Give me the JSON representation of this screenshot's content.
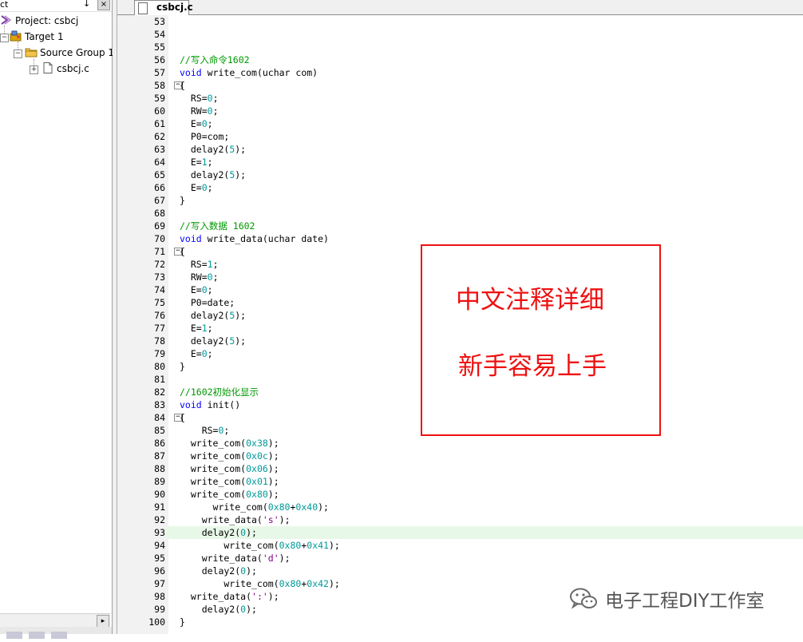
{
  "project_panel": {
    "title": "ct",
    "pin": "↓",
    "close": "×",
    "tree": [
      {
        "label": "Project: csbcj",
        "icon": "project-icon"
      },
      {
        "label": "Target 1",
        "icon": "target-icon"
      },
      {
        "label": "Source Group 1",
        "icon": "folder-icon"
      },
      {
        "label": "csbcj.c",
        "icon": "file-icon"
      }
    ],
    "scroll_right": "▸"
  },
  "editor": {
    "tab_label": "csbcj.c",
    "highlight_line": "93",
    "lines": [
      {
        "n": "53",
        "fold": "",
        "code": []
      },
      {
        "n": "54",
        "fold": "",
        "code": []
      },
      {
        "n": "55",
        "fold": "",
        "code": []
      },
      {
        "n": "56",
        "fold": "",
        "code": [
          {
            "t": "//写入命令1602",
            "c": "cm"
          }
        ]
      },
      {
        "n": "57",
        "fold": "",
        "code": [
          {
            "t": "void",
            "c": "kw"
          },
          {
            "t": " write_com(uchar com)",
            "c": ""
          }
        ]
      },
      {
        "n": "58",
        "fold": "−",
        "code": [
          {
            "t": "{",
            "c": ""
          }
        ]
      },
      {
        "n": "59",
        "fold": "",
        "code": [
          {
            "t": "  RS=",
            "c": ""
          },
          {
            "t": "0",
            "c": "nm"
          },
          {
            "t": ";",
            "c": ""
          }
        ]
      },
      {
        "n": "60",
        "fold": "",
        "code": [
          {
            "t": "  RW=",
            "c": ""
          },
          {
            "t": "0",
            "c": "nm"
          },
          {
            "t": ";",
            "c": ""
          }
        ]
      },
      {
        "n": "61",
        "fold": "",
        "code": [
          {
            "t": "  E=",
            "c": ""
          },
          {
            "t": "0",
            "c": "nm"
          },
          {
            "t": ";",
            "c": ""
          }
        ]
      },
      {
        "n": "62",
        "fold": "",
        "code": [
          {
            "t": "  P0=com;",
            "c": ""
          }
        ]
      },
      {
        "n": "63",
        "fold": "",
        "code": [
          {
            "t": "  delay2(",
            "c": ""
          },
          {
            "t": "5",
            "c": "nm"
          },
          {
            "t": ");",
            "c": ""
          }
        ]
      },
      {
        "n": "64",
        "fold": "",
        "code": [
          {
            "t": "  E=",
            "c": ""
          },
          {
            "t": "1",
            "c": "nm"
          },
          {
            "t": ";",
            "c": ""
          }
        ]
      },
      {
        "n": "65",
        "fold": "",
        "code": [
          {
            "t": "  delay2(",
            "c": ""
          },
          {
            "t": "5",
            "c": "nm"
          },
          {
            "t": ");",
            "c": ""
          }
        ]
      },
      {
        "n": "66",
        "fold": "",
        "code": [
          {
            "t": "  E=",
            "c": ""
          },
          {
            "t": "0",
            "c": "nm"
          },
          {
            "t": ";",
            "c": ""
          }
        ]
      },
      {
        "n": "67",
        "fold": "",
        "code": [
          {
            "t": "}",
            "c": ""
          }
        ]
      },
      {
        "n": "68",
        "fold": "",
        "code": []
      },
      {
        "n": "69",
        "fold": "",
        "code": [
          {
            "t": "//写入数据 1602",
            "c": "cm"
          }
        ]
      },
      {
        "n": "70",
        "fold": "",
        "code": [
          {
            "t": "void",
            "c": "kw"
          },
          {
            "t": " write_data(uchar date)",
            "c": ""
          }
        ]
      },
      {
        "n": "71",
        "fold": "−",
        "code": [
          {
            "t": "{",
            "c": ""
          }
        ]
      },
      {
        "n": "72",
        "fold": "",
        "code": [
          {
            "t": "  RS=",
            "c": ""
          },
          {
            "t": "1",
            "c": "nm"
          },
          {
            "t": ";",
            "c": ""
          }
        ]
      },
      {
        "n": "73",
        "fold": "",
        "code": [
          {
            "t": "  RW=",
            "c": ""
          },
          {
            "t": "0",
            "c": "nm"
          },
          {
            "t": ";",
            "c": ""
          }
        ]
      },
      {
        "n": "74",
        "fold": "",
        "code": [
          {
            "t": "  E=",
            "c": ""
          },
          {
            "t": "0",
            "c": "nm"
          },
          {
            "t": ";",
            "c": ""
          }
        ]
      },
      {
        "n": "75",
        "fold": "",
        "code": [
          {
            "t": "  P0=date;",
            "c": ""
          }
        ]
      },
      {
        "n": "76",
        "fold": "",
        "code": [
          {
            "t": "  delay2(",
            "c": ""
          },
          {
            "t": "5",
            "c": "nm"
          },
          {
            "t": ");",
            "c": ""
          }
        ]
      },
      {
        "n": "77",
        "fold": "",
        "code": [
          {
            "t": "  E=",
            "c": ""
          },
          {
            "t": "1",
            "c": "nm"
          },
          {
            "t": ";",
            "c": ""
          }
        ]
      },
      {
        "n": "78",
        "fold": "",
        "code": [
          {
            "t": "  delay2(",
            "c": ""
          },
          {
            "t": "5",
            "c": "nm"
          },
          {
            "t": ");",
            "c": ""
          }
        ]
      },
      {
        "n": "79",
        "fold": "",
        "code": [
          {
            "t": "  E=",
            "c": ""
          },
          {
            "t": "0",
            "c": "nm"
          },
          {
            "t": ";",
            "c": ""
          }
        ]
      },
      {
        "n": "80",
        "fold": "",
        "code": [
          {
            "t": "}",
            "c": ""
          }
        ]
      },
      {
        "n": "81",
        "fold": "",
        "code": []
      },
      {
        "n": "82",
        "fold": "",
        "code": [
          {
            "t": "//1602初始化显示",
            "c": "cm"
          }
        ]
      },
      {
        "n": "83",
        "fold": "",
        "code": [
          {
            "t": "void",
            "c": "kw"
          },
          {
            "t": " init()",
            "c": ""
          }
        ]
      },
      {
        "n": "84",
        "fold": "−",
        "code": [
          {
            "t": "{",
            "c": ""
          }
        ]
      },
      {
        "n": "85",
        "fold": "",
        "code": [
          {
            "t": "    RS=",
            "c": ""
          },
          {
            "t": "0",
            "c": "nm"
          },
          {
            "t": ";",
            "c": ""
          }
        ]
      },
      {
        "n": "86",
        "fold": "",
        "code": [
          {
            "t": "  write_com(",
            "c": ""
          },
          {
            "t": "0x38",
            "c": "nm"
          },
          {
            "t": ");",
            "c": ""
          }
        ]
      },
      {
        "n": "87",
        "fold": "",
        "code": [
          {
            "t": "  write_com(",
            "c": ""
          },
          {
            "t": "0x0c",
            "c": "nm"
          },
          {
            "t": ");",
            "c": ""
          }
        ]
      },
      {
        "n": "88",
        "fold": "",
        "code": [
          {
            "t": "  write_com(",
            "c": ""
          },
          {
            "t": "0x06",
            "c": "nm"
          },
          {
            "t": ");",
            "c": ""
          }
        ]
      },
      {
        "n": "89",
        "fold": "",
        "code": [
          {
            "t": "  write_com(",
            "c": ""
          },
          {
            "t": "0x01",
            "c": "nm"
          },
          {
            "t": ");",
            "c": ""
          }
        ]
      },
      {
        "n": "90",
        "fold": "",
        "code": [
          {
            "t": "  write_com(",
            "c": ""
          },
          {
            "t": "0x80",
            "c": "nm"
          },
          {
            "t": ");",
            "c": ""
          }
        ]
      },
      {
        "n": "91",
        "fold": "",
        "code": [
          {
            "t": "      write_com(",
            "c": ""
          },
          {
            "t": "0x80",
            "c": "nm"
          },
          {
            "t": "+",
            "c": ""
          },
          {
            "t": "0x40",
            "c": "nm"
          },
          {
            "t": ");",
            "c": ""
          }
        ]
      },
      {
        "n": "92",
        "fold": "",
        "code": [
          {
            "t": "    write_data(",
            "c": ""
          },
          {
            "t": "'s'",
            "c": "st"
          },
          {
            "t": ");",
            "c": ""
          }
        ]
      },
      {
        "n": "93",
        "fold": "",
        "code": [
          {
            "t": "    delay2(",
            "c": ""
          },
          {
            "t": "0",
            "c": "nm"
          },
          {
            "t": ");",
            "c": ""
          }
        ]
      },
      {
        "n": "94",
        "fold": "",
        "code": [
          {
            "t": "        write_com(",
            "c": ""
          },
          {
            "t": "0x80",
            "c": "nm"
          },
          {
            "t": "+",
            "c": ""
          },
          {
            "t": "0x41",
            "c": "nm"
          },
          {
            "t": ");",
            "c": ""
          }
        ]
      },
      {
        "n": "95",
        "fold": "",
        "code": [
          {
            "t": "    write_data(",
            "c": ""
          },
          {
            "t": "'d'",
            "c": "st"
          },
          {
            "t": ");",
            "c": ""
          }
        ]
      },
      {
        "n": "96",
        "fold": "",
        "code": [
          {
            "t": "    delay2(",
            "c": ""
          },
          {
            "t": "0",
            "c": "nm"
          },
          {
            "t": ");",
            "c": ""
          }
        ]
      },
      {
        "n": "97",
        "fold": "",
        "code": [
          {
            "t": "        write_com(",
            "c": ""
          },
          {
            "t": "0x80",
            "c": "nm"
          },
          {
            "t": "+",
            "c": ""
          },
          {
            "t": "0x42",
            "c": "nm"
          },
          {
            "t": ");",
            "c": ""
          }
        ]
      },
      {
        "n": "98",
        "fold": "",
        "code": [
          {
            "t": "  write_data(",
            "c": ""
          },
          {
            "t": "':'",
            "c": "st"
          },
          {
            "t": ");",
            "c": ""
          }
        ]
      },
      {
        "n": "99",
        "fold": "",
        "code": [
          {
            "t": "    delay2(",
            "c": ""
          },
          {
            "t": "0",
            "c": "nm"
          },
          {
            "t": ");",
            "c": ""
          }
        ]
      },
      {
        "n": "100",
        "fold": "",
        "code": [
          {
            "t": "}",
            "c": ""
          }
        ]
      }
    ]
  },
  "annotation": {
    "line1": "中文注释详细",
    "line2": "新手容易上手",
    "color": "#ee1111"
  },
  "watermark": {
    "text": "电子工程DIY工作室",
    "icon": "wechat-icon"
  },
  "colors": {
    "comment": "#009900",
    "keyword": "#0000ff",
    "number": "#009999",
    "string": "#8b008b",
    "highlight": "#e8f8e8"
  }
}
